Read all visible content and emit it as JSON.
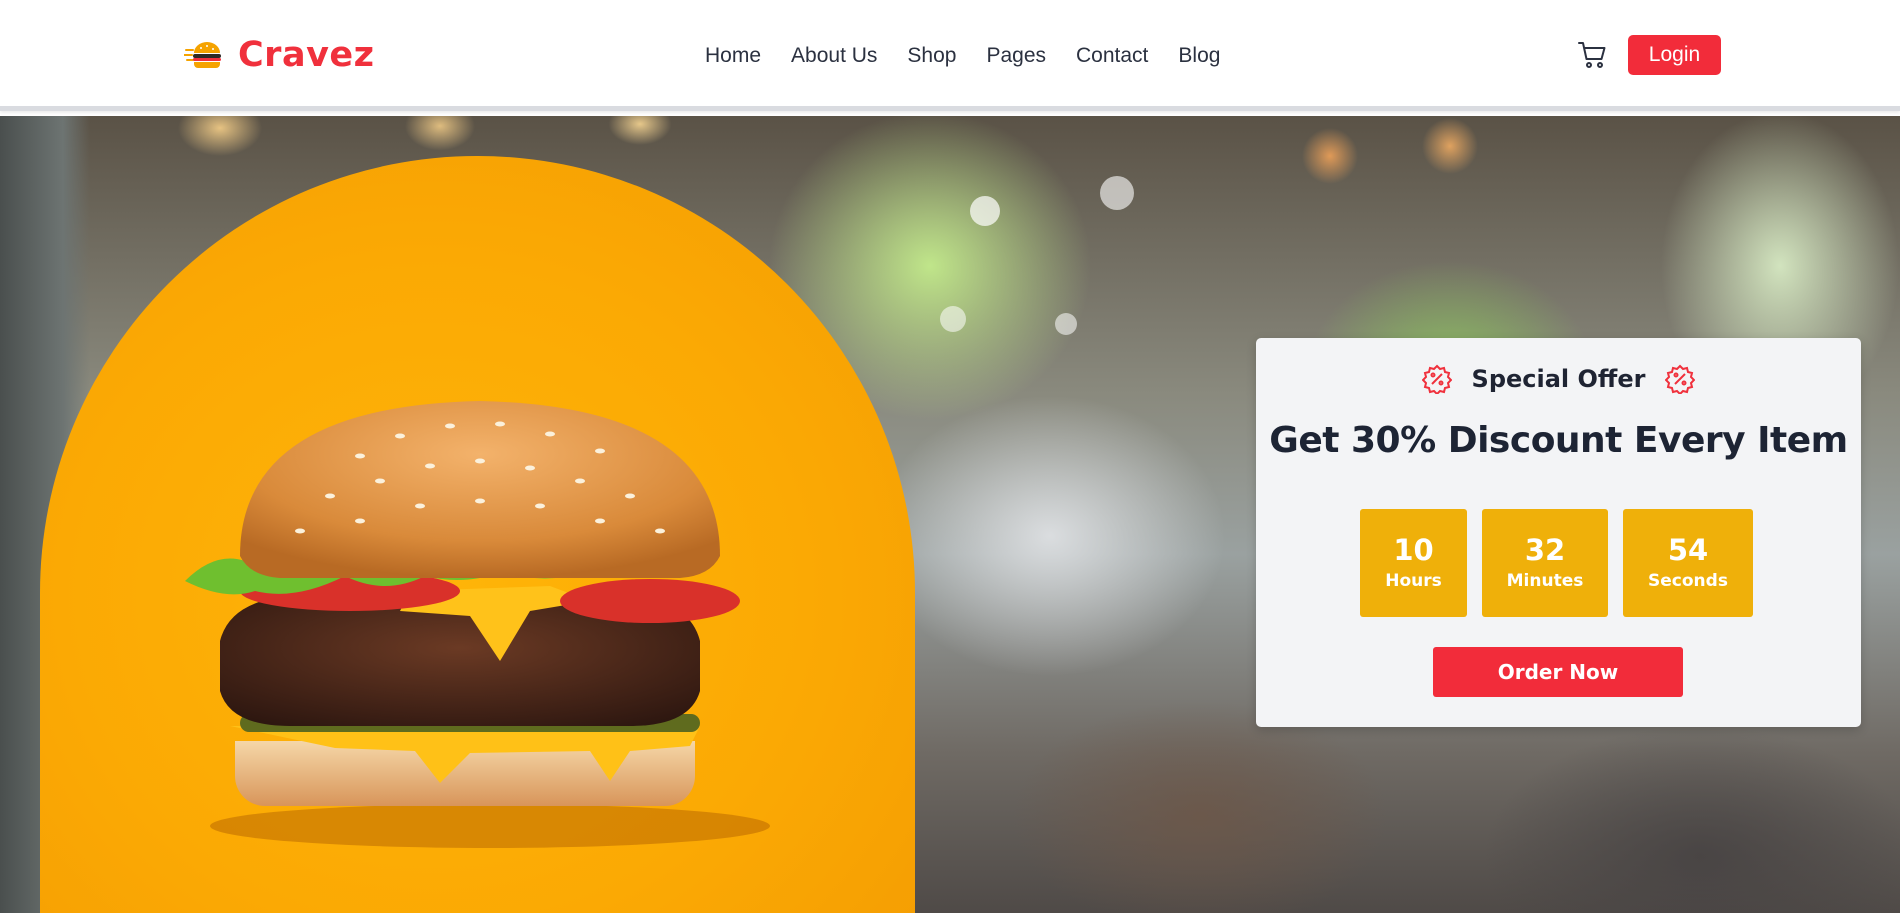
{
  "brand": {
    "name": "Cravez",
    "logo_icon": "burger-icon",
    "color": "#f0303c"
  },
  "nav": {
    "items": [
      {
        "label": "Home"
      },
      {
        "label": "About Us"
      },
      {
        "label": "Shop"
      },
      {
        "label": "Pages"
      },
      {
        "label": "Contact"
      },
      {
        "label": "Blog"
      }
    ],
    "cart_icon": "shopping-cart-icon",
    "login_label": "Login"
  },
  "hero": {
    "image": "burger-photo",
    "background": "blurred-restaurant-interior",
    "arch_color": "#fba904"
  },
  "offer": {
    "label": "Special Offer",
    "badge_icon": "discount-badge-icon",
    "title": "Get 30% Discount Every Item",
    "countdown": {
      "hours": {
        "value": "10",
        "unit": "Hours"
      },
      "minutes": {
        "value": "32",
        "unit": "Minutes"
      },
      "seconds": {
        "value": "54",
        "unit": "Seconds"
      }
    },
    "cta_label": "Order Now",
    "accent_color": "#f22c3a",
    "timer_color": "#efb00a"
  }
}
